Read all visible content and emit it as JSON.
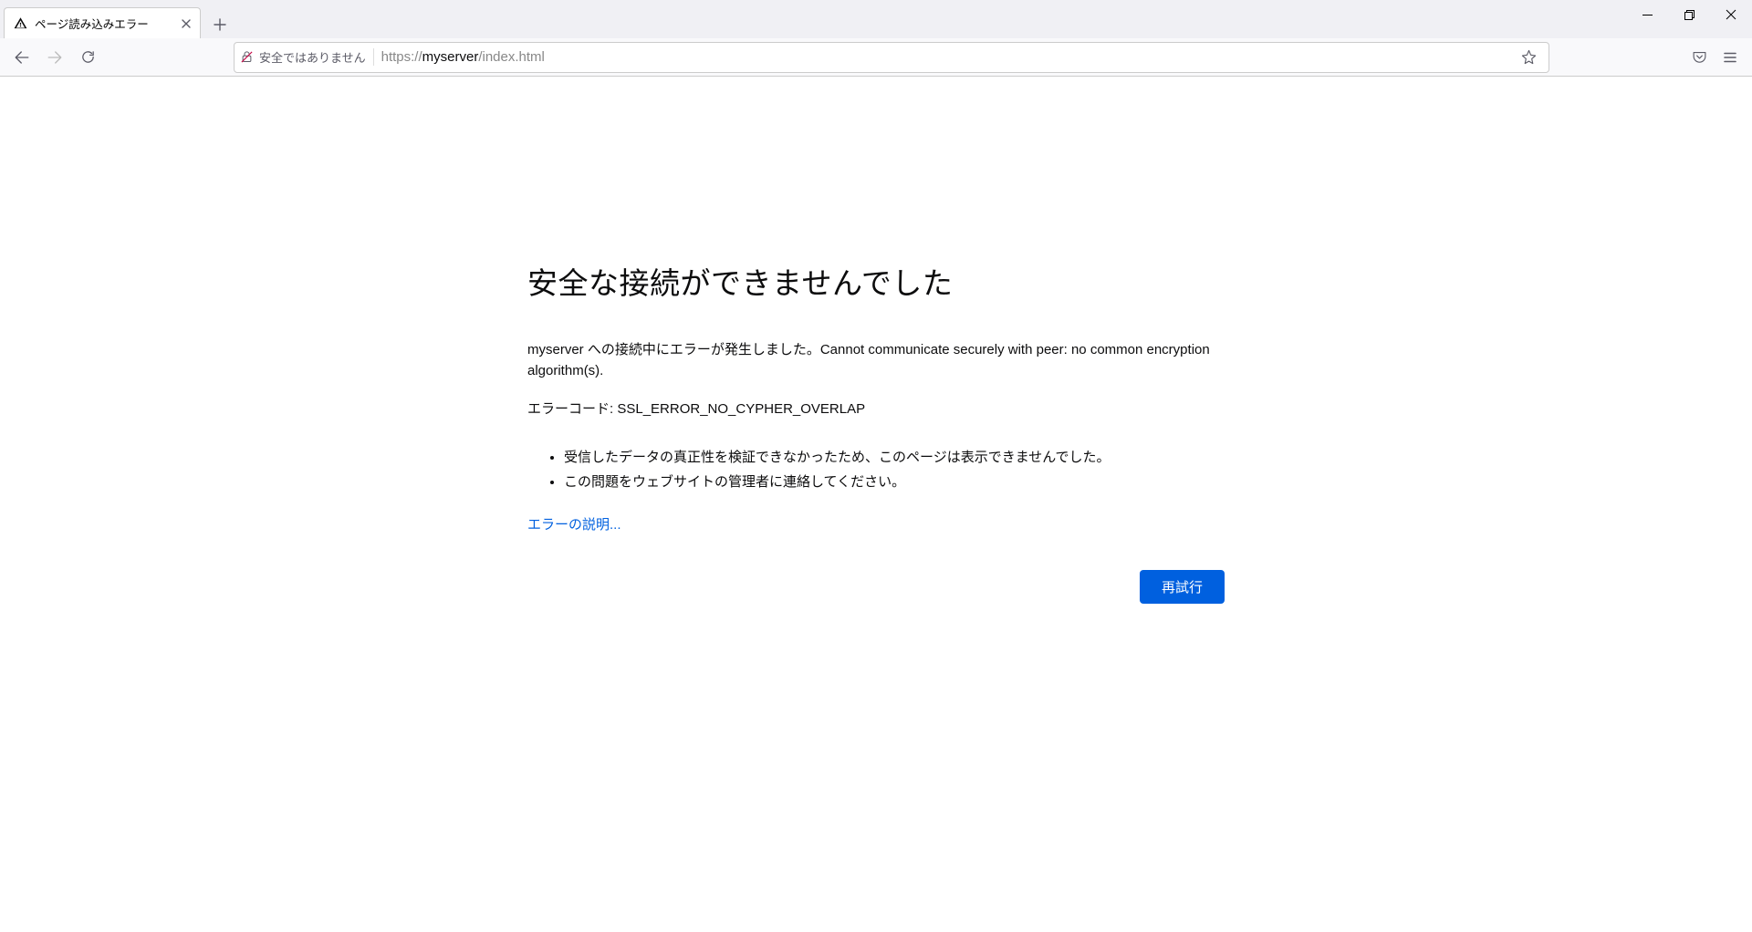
{
  "tab": {
    "title": "ページ読み込みエラー"
  },
  "toolbar": {
    "security_label": "安全ではありません",
    "url_prefix": "https://",
    "url_host": "myserver",
    "url_path": "/index.html"
  },
  "error": {
    "title": "安全な接続ができませんでした",
    "description": "myserver への接続中にエラーが発生しました。Cannot communicate securely with peer: no common encryption algorithm(s).",
    "code_label": "エラーコード: ",
    "code_value": "SSL_ERROR_NO_CYPHER_OVERLAP",
    "bullets": [
      "受信したデータの真正性を検証できなかったため、このページは表示できませんでした。",
      "この問題をウェブサイトの管理者に連絡してください。"
    ],
    "learn_more": "エラーの説明...",
    "retry": "再試行"
  }
}
